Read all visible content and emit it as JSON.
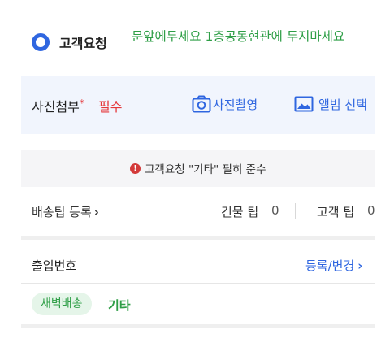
{
  "customer_request": {
    "label": "고객요청",
    "text": "문앞에두세요 1층공동현관에 두지마세요"
  },
  "photo": {
    "label": "사진첨부",
    "required_mark": "*",
    "required_text": "필수",
    "camera_label": "사진촬영",
    "album_label": "앨범 선택"
  },
  "warning": {
    "icon": "!",
    "text": "고객요청 \"기타\" 필히 준수"
  },
  "tips": {
    "register_label": "배송팁 등록",
    "register_chevron": "›",
    "building_label": "건물 팁",
    "building_count": "0",
    "customer_label": "고객 팁",
    "customer_count": "0"
  },
  "entrance": {
    "label": "출입번호",
    "action_label": "등록/변경",
    "action_chevron": "›"
  },
  "tags": {
    "dawn": "새벽배송",
    "etc": "기타"
  },
  "colors": {
    "accent_blue": "#2f66e0",
    "green": "#2e9e46",
    "red": "#e5383b"
  },
  "icons": {
    "radio": "radio-selected-icon",
    "camera": "camera-icon",
    "album": "image-icon",
    "warning": "warning-icon"
  }
}
